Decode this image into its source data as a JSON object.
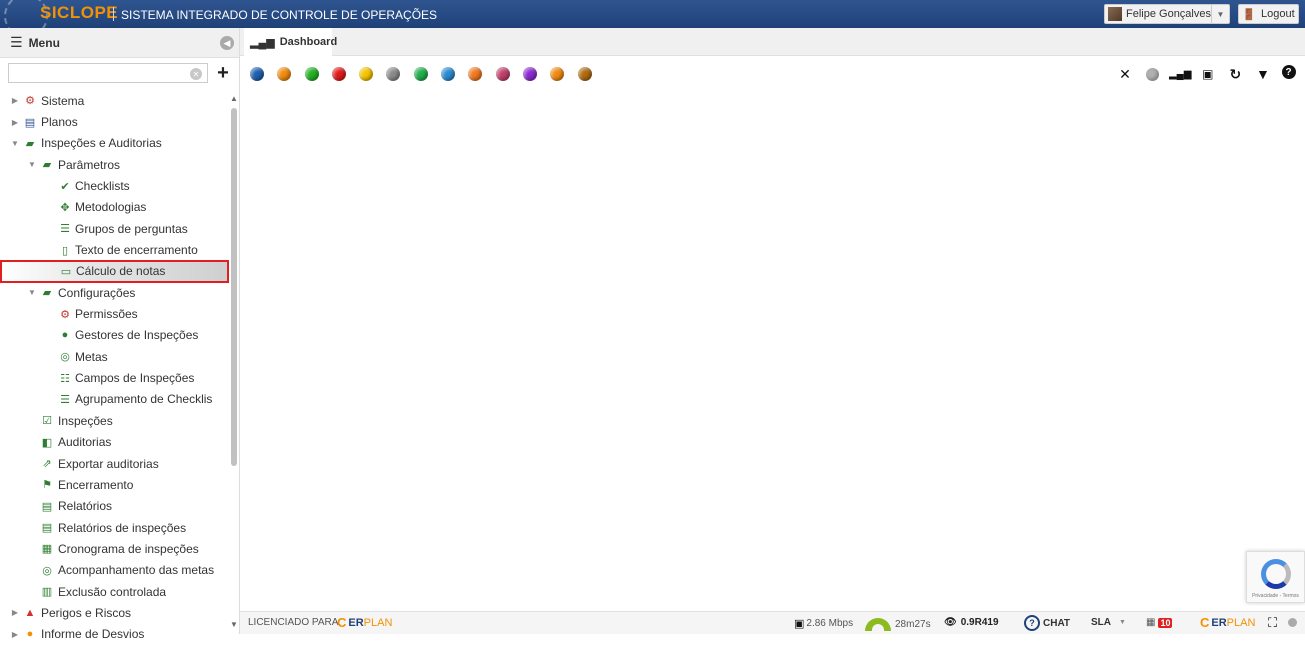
{
  "header": {
    "logo_text": "SICLOPE",
    "app_title": "SISTEMA INTEGRADO DE CONTROLE DE OPERAÇÕES",
    "user_name": "Felipe Gonçalves",
    "logout_label": "Logout"
  },
  "sidebar": {
    "menu_label": "Menu",
    "search_placeholder": "",
    "items": [
      {
        "label": "Sistema",
        "icon": "gear-icon",
        "level": 0,
        "expanded": false
      },
      {
        "label": "Planos",
        "icon": "calendar-icon",
        "level": 0,
        "expanded": false
      },
      {
        "label": "Inspeções e Auditorias",
        "icon": "folder-open-icon",
        "level": 0,
        "expanded": true
      },
      {
        "label": "Parâmetros",
        "icon": "folder-open-icon",
        "level": 1,
        "expanded": true
      },
      {
        "label": "Checklists",
        "icon": "checkmark-icon",
        "level": 2
      },
      {
        "label": "Metodologias",
        "icon": "move-arrows-icon",
        "level": 2
      },
      {
        "label": "Grupos de perguntas",
        "icon": "list-box-icon",
        "level": 2
      },
      {
        "label": "Texto de encerramento",
        "icon": "book-icon",
        "level": 2
      },
      {
        "label": "Cálculo de notas",
        "icon": "calc-icon",
        "level": 2,
        "selected": true
      },
      {
        "label": "Configurações",
        "icon": "folder-open-icon",
        "level": 1,
        "expanded": true
      },
      {
        "label": "Permissões",
        "icon": "gear-icon",
        "level": 2
      },
      {
        "label": "Gestores de Inspeções",
        "icon": "user-circle-icon",
        "level": 2
      },
      {
        "label": "Metas",
        "icon": "target-icon",
        "level": 2
      },
      {
        "label": "Campos de Inspeções",
        "icon": "fields-list-icon",
        "level": 2
      },
      {
        "label": "Agrupamento de Checklis",
        "icon": "list-box-icon",
        "level": 2
      },
      {
        "label": "Inspeções",
        "icon": "clipboard-check-icon",
        "level": 1
      },
      {
        "label": "Auditorias",
        "icon": "audit-icon",
        "level": 1
      },
      {
        "label": "Exportar auditorias",
        "icon": "export-icon",
        "level": 1
      },
      {
        "label": "Encerramento",
        "icon": "flag-icon",
        "level": 1
      },
      {
        "label": "Relatórios",
        "icon": "pdf-icon",
        "level": 1
      },
      {
        "label": "Relatórios de inspeções",
        "icon": "pdf-icon",
        "level": 1
      },
      {
        "label": "Cronograma de inspeções",
        "icon": "schedule-icon",
        "level": 1
      },
      {
        "label": "Acompanhamento das metas",
        "icon": "target-icon",
        "level": 1
      },
      {
        "label": "Exclusão controlada",
        "icon": "trash-icon",
        "level": 1
      },
      {
        "label": "Perigos e Riscos",
        "icon": "warning-icon",
        "level": 0,
        "expanded": false
      },
      {
        "label": "Informe de Desvios",
        "icon": "report-icon",
        "level": 0,
        "expanded": false
      }
    ]
  },
  "tabs": [
    {
      "label": "Dashboard",
      "icon": "bar-signal-icon"
    }
  ],
  "dashboard": {
    "dot_colors": [
      "#1f5fb0",
      "#f08a10",
      "#22b022",
      "#e01a1a",
      "#f5c400",
      "#8a8a8a",
      "#1fae4a",
      "#2a8ad0",
      "#f07820",
      "#c0406a",
      "#8a2ad0",
      "#f08a10",
      "#b06a10"
    ]
  },
  "statusbar": {
    "licensed_label": "LICENCIADO PARA:",
    "company_c": "C",
    "company_er": "ER",
    "company_plan": "PLAN",
    "speed": "2.86 Mbps",
    "session_time": "28m27s",
    "version": "0.9R419",
    "chat_label": "CHAT",
    "sla_label": "SLA",
    "notif_count": "10"
  },
  "recaptcha": {
    "terms": "Privacidade - Termos"
  }
}
